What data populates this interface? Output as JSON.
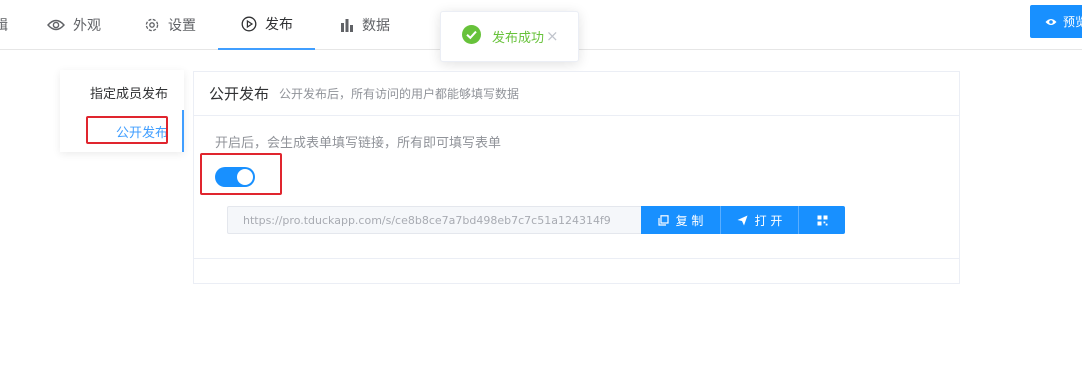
{
  "nav": {
    "cut_label": "辑",
    "tabs": [
      {
        "label": "外观",
        "icon": "eye-icon"
      },
      {
        "label": "设置",
        "icon": "gear-icon"
      },
      {
        "label": "发布",
        "icon": "play-circle-icon",
        "active": true
      },
      {
        "label": "数据",
        "icon": "bar-chart-icon"
      }
    ],
    "preview_label": "预览"
  },
  "toast": {
    "message": "发布成功",
    "close": "×",
    "icon": "check-circle-icon",
    "color": "#67c23a"
  },
  "side_menu": {
    "items": [
      {
        "label": "指定成员发布"
      },
      {
        "label": "公开发布",
        "active": true
      }
    ]
  },
  "card": {
    "title": "公开发布",
    "subtitle": "公开发布后，所有访问的用户都能够填写数据",
    "hint": "开启后，会生成表单填写链接，所有即可填写表单",
    "switch_on": true,
    "link": "https://pro.tduckapp.com/s/ce8b8ce7a7bd498eb7c7c51a124314f9",
    "copy_label": "复 制",
    "open_label": "打 开",
    "qr_icon": "qrcode-icon"
  },
  "colors": {
    "accent": "#1890ff",
    "highlight": "#e0252e",
    "success": "#67c23a"
  }
}
